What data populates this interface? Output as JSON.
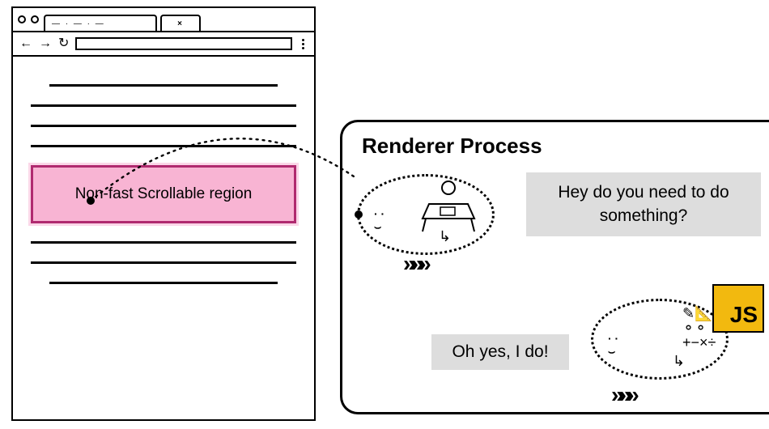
{
  "browser": {
    "tab_label": "— · — · —",
    "close_glyph": "×",
    "region_label": "Non-fast Scrollable region"
  },
  "renderer": {
    "title": "Renderer Process",
    "bubble1": "Hey do you need to do something?",
    "bubble2": "Oh yes, I do!",
    "js_label": "JS"
  },
  "icons": {
    "back": "←",
    "forward": "→",
    "reload": "↻",
    "motion": "»»»",
    "pass": "↳",
    "tools": "✎📐\n⚬⚬\n+−×÷"
  }
}
